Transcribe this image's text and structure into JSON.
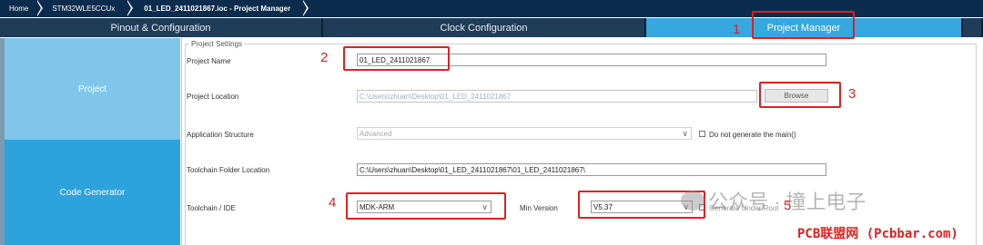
{
  "breadcrumb": [
    "Home",
    "STM32WLE5CCUx",
    "01_LED_2411021867.ioc - Project Manager"
  ],
  "tabs": [
    "Pinout & Configuration",
    "Clock Configuration",
    "Project Manager"
  ],
  "sidebar": {
    "items": [
      "Project",
      "Code Generator"
    ]
  },
  "settings": {
    "legend": "Project Settings",
    "project_name_label": "Project Name",
    "project_name_value": "01_LED_2411021867",
    "project_location_label": "Project Location",
    "project_location_value": "C:\\Users\\zhuan\\Desktop\\01_LED_2411021867",
    "browse_label": "Browse",
    "app_structure_label": "Application Structure",
    "app_structure_value": "Advanced",
    "no_main_label": "Do not generate the main()",
    "toolchain_folder_label": "Toolchain Folder Location",
    "toolchain_folder_value": "C:\\Users\\zhuan\\Desktop\\01_LED_2411021867\\01_LED_2411021867\\",
    "toolchain_ide_label": "Toolchain / IDE",
    "toolchain_ide_value": "MDK-ARM",
    "min_version_label": "Min Version",
    "min_version_value": "V5.37",
    "generate_under_root_label": "Generate Under Root"
  },
  "annotations": [
    "1",
    "2",
    "3",
    "4",
    "5"
  ],
  "watermarks": {
    "wechat": "公众号 · 撞上电子",
    "site": "PCB联盟网 (Pcbbar.com)"
  },
  "colors": {
    "active_tab": "#36a7df",
    "sidebar_active": "#7fc6ea",
    "sidebar_item": "#2da2db",
    "annotation": "#e02020",
    "header": "#0b2c4c"
  }
}
